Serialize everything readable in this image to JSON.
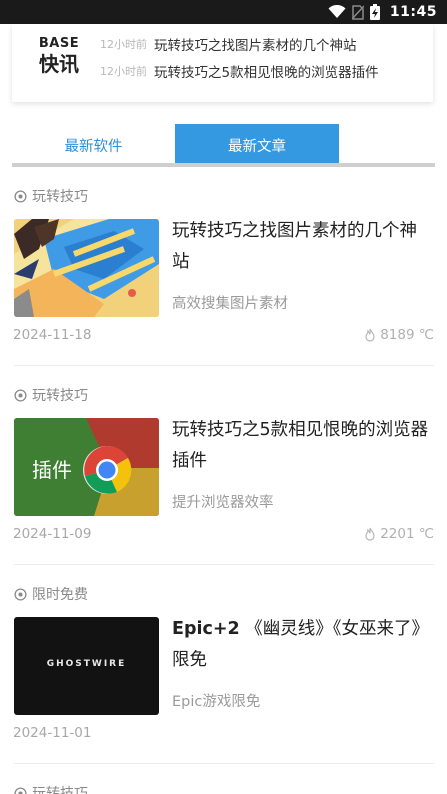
{
  "status_bar": {
    "time": "11:45",
    "battery_level": "⚡"
  },
  "news_card": {
    "logo_top": "BASE",
    "logo_bottom": "快讯",
    "items": [
      {
        "ago": "12小时前",
        "headline": "玩转技巧之找图片素材的几个神站"
      },
      {
        "ago": "12小时前",
        "headline": "玩转技巧之5款相见恨晚的浏览器插件"
      }
    ]
  },
  "tabs": {
    "software": "最新软件",
    "articles": "最新文章",
    "active": "articles"
  },
  "articles": [
    {
      "category": "玩转技巧",
      "title": "玩转技巧之找图片素材的几个神站",
      "subtitle": "高效搜集图片素材",
      "date": "2024-11-18",
      "heat": "8189 ℃",
      "thumb": "map-illustration"
    },
    {
      "category": "玩转技巧",
      "title": "玩转技巧之5款相见恨晚的浏览器插件",
      "subtitle": "提升浏览器效率",
      "date": "2024-11-09",
      "heat": "2201 ℃",
      "thumb": "chrome-plugins",
      "thumb_text": "插件"
    },
    {
      "category": "限时免费",
      "title": "Epic+2 《幽灵线》《女巫来了》限免",
      "title_bold_part": "Epic+2",
      "title_rest": " 《幽灵线》《女巫来了》限免",
      "subtitle": "Epic游戏限免",
      "date": "2024-11-01",
      "thumb": "ghostwire",
      "thumb_text": "GHOSTWIRE"
    },
    {
      "category": "玩转技巧"
    }
  ],
  "colors": {
    "accent": "#3499e0",
    "accent_text": "#2f8fd8",
    "muted": "#9b9b9b"
  }
}
